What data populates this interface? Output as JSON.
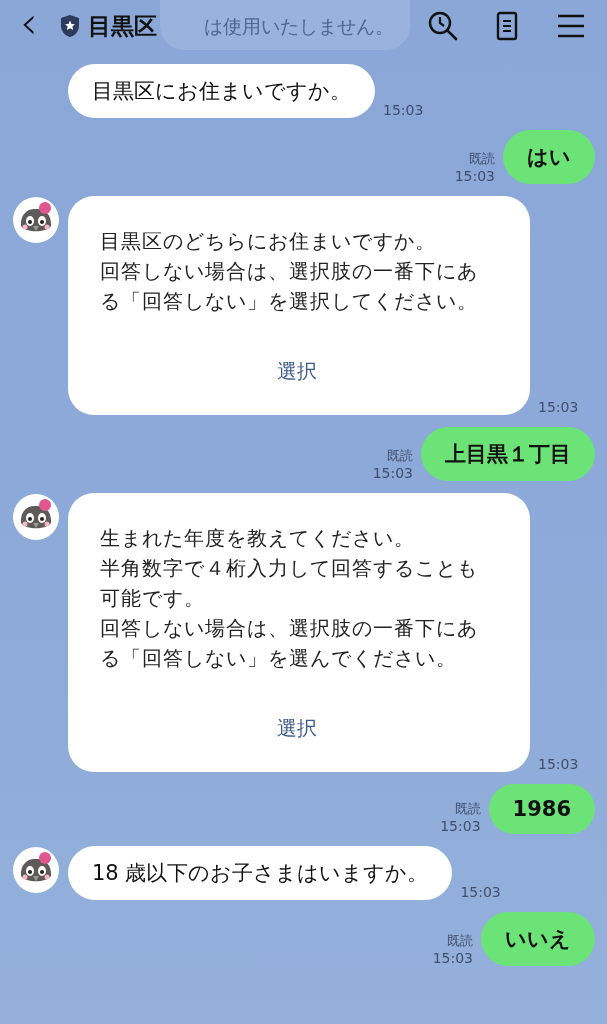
{
  "header": {
    "back": "‹",
    "title": "目黒区",
    "faded_text": "は使用いたしません。"
  },
  "messages": [
    {
      "kind": "bot-text",
      "avatar": false,
      "text": "目黒区にお住まいですか。",
      "time": "15:03"
    },
    {
      "kind": "user",
      "text": "はい",
      "read": "既読",
      "time": "15:03"
    },
    {
      "kind": "bot-card",
      "avatar": true,
      "paragraphs": [
        "目黒区のどちらにお住まいですか。",
        "回答しない場合は、選択肢の一番下にある「回答しない」を選択してください。"
      ],
      "action": "選択",
      "time": "15:03"
    },
    {
      "kind": "user",
      "text": "上目黒１丁目",
      "read": "既読",
      "time": "15:03"
    },
    {
      "kind": "bot-card",
      "avatar": true,
      "paragraphs": [
        "生まれた年度を教えてください。",
        "半角数字で４桁入力して回答することも可能です。",
        "回答しない場合は、選択肢の一番下にある「回答しない」を選んでください。"
      ],
      "action": "選択",
      "time": "15:03"
    },
    {
      "kind": "user",
      "text": "1986",
      "read": "既読",
      "time": "15:03"
    },
    {
      "kind": "bot-text",
      "avatar": true,
      "text": "18 歳以下のお子さまはいますか。",
      "time": "15:03"
    },
    {
      "kind": "user",
      "text": "いいえ",
      "read": "既読",
      "time": "15:03"
    }
  ]
}
